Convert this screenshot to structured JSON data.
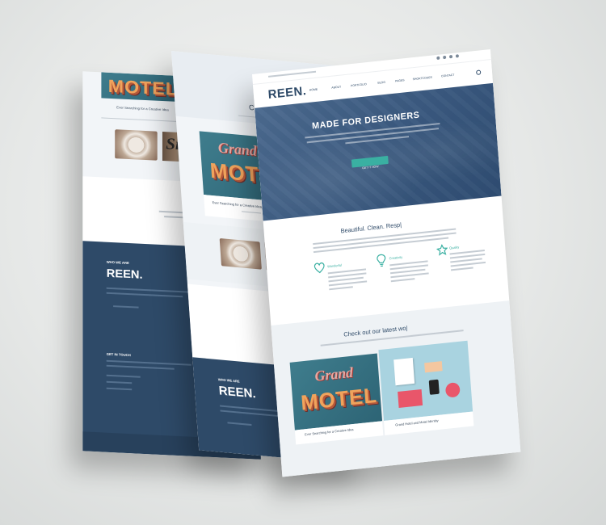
{
  "brand": "REEN.",
  "hero": {
    "heading": "MADE FOR DESIGNERS",
    "cta": "GET IT NOW"
  },
  "nav_items": [
    "HOME",
    "ABOUT",
    "PORTFOLIO",
    "BLOG",
    "PAGES",
    "SHORTCODES",
    "CONTACT"
  ],
  "features": {
    "heading": "Beautiful. Clean. Resp|",
    "items": [
      {
        "label": "Wonderful",
        "icon": "heart-icon"
      },
      {
        "label": "Creativity",
        "icon": "lightbulb-icon"
      },
      {
        "label": "Quality",
        "icon": "star-icon"
      }
    ]
  },
  "portfolio": {
    "heading": "Check out our latest wo|",
    "back_heading": "Che",
    "grand": "Grand",
    "motel": "MOTEL",
    "item1_caption": "Ever Searching for a Creative Idea",
    "item2_caption": "Grand Hotel and Motel Identity",
    "small_caption": "Sign"
  },
  "footer": {
    "who_we_are": "WHO WE ARE",
    "brand": "REEN.",
    "get_in_touch": "GET IN TOUCH",
    "back_wh": "W",
    "mid_wh": "Wh"
  },
  "colors": {
    "navy": "#2e4a68",
    "teal": "#3ab0a2",
    "hero_overlay": "#3f5f86"
  }
}
